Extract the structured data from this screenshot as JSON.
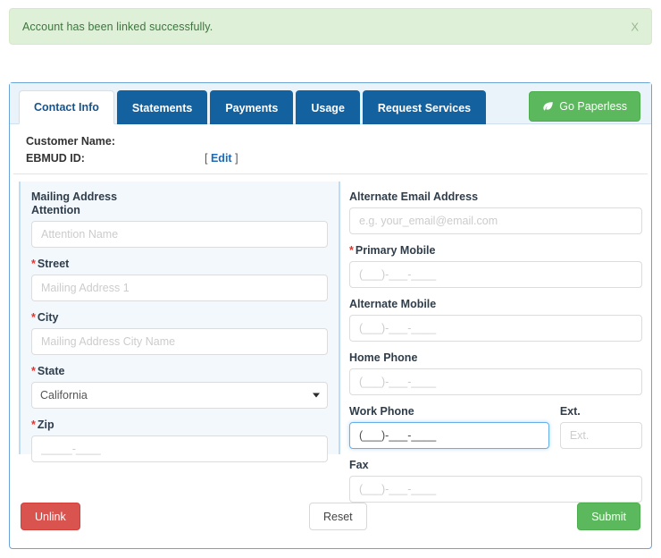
{
  "alert": {
    "message": "Account has been linked successfully.",
    "close_label": "X",
    "bg_color": "#dff0d8",
    "text_color": "#3c763d"
  },
  "tabs": [
    {
      "label": "Contact Info",
      "active": true
    },
    {
      "label": "Statements",
      "active": false
    },
    {
      "label": "Payments",
      "active": false
    },
    {
      "label": "Usage",
      "active": false
    },
    {
      "label": "Request Services",
      "active": false
    }
  ],
  "header": {
    "paperless_label": "Go Paperless",
    "paperless_color": "#5cb85c",
    "tab_active_color": "#ffffff",
    "tab_inactive_color": "#14619f"
  },
  "customer": {
    "name_label": "Customer Name:",
    "name_value": "",
    "id_label": "EBMUD ID:",
    "id_value": "",
    "edit_open": "[",
    "edit_label": "Edit",
    "edit_close": "]",
    "edit_color": "#1e6bb8"
  },
  "form": {
    "mailing_group_title": "Mailing Address",
    "left_fields": [
      {
        "label": "Attention",
        "required": false,
        "type": "text",
        "value": "",
        "placeholder": "Attention Name",
        "focused": false
      },
      {
        "label": "Street",
        "required": true,
        "type": "text",
        "value": "",
        "placeholder": "Mailing Address 1",
        "focused": false
      },
      {
        "label": "City",
        "required": true,
        "type": "text",
        "value": "",
        "placeholder": "Mailing Address City Name",
        "focused": false
      },
      {
        "label": "State",
        "required": true,
        "type": "select",
        "value": "California",
        "placeholder": "",
        "focused": false
      },
      {
        "label": "Zip",
        "required": true,
        "type": "text",
        "value": "",
        "placeholder": "_____-____",
        "focused": false
      }
    ],
    "right_fields": [
      {
        "label": "Alternate Email Address",
        "required": false,
        "type": "text",
        "value": "",
        "placeholder": "e.g. your_email@email.com",
        "focused": false
      },
      {
        "label": "Primary Mobile",
        "required": true,
        "type": "text",
        "value": "",
        "placeholder": "(___)-___-____",
        "focused": false
      },
      {
        "label": "Alternate Mobile",
        "required": false,
        "type": "text",
        "value": "",
        "placeholder": "(___)-___-____",
        "focused": false
      },
      {
        "label": "Home Phone",
        "required": false,
        "type": "text",
        "value": "",
        "placeholder": "(___)-___-____",
        "focused": false
      }
    ],
    "work_phone": {
      "label": "Work Phone",
      "required": false,
      "value": "",
      "placeholder": "(___)-___-____",
      "focused": true
    },
    "ext": {
      "label": "Ext.",
      "required": false,
      "value": "",
      "placeholder": "Ext.",
      "focused": false
    },
    "fax": {
      "label": "Fax",
      "required": false,
      "value": "",
      "placeholder": "(___)-___-____",
      "focused": false
    },
    "required_marker": "*",
    "required_color": "#e8322a"
  },
  "footer": {
    "unlink_label": "Unlink",
    "unlink_color": "#d9534f",
    "reset_label": "Reset",
    "submit_label": "Submit",
    "submit_color": "#5cb85c"
  }
}
